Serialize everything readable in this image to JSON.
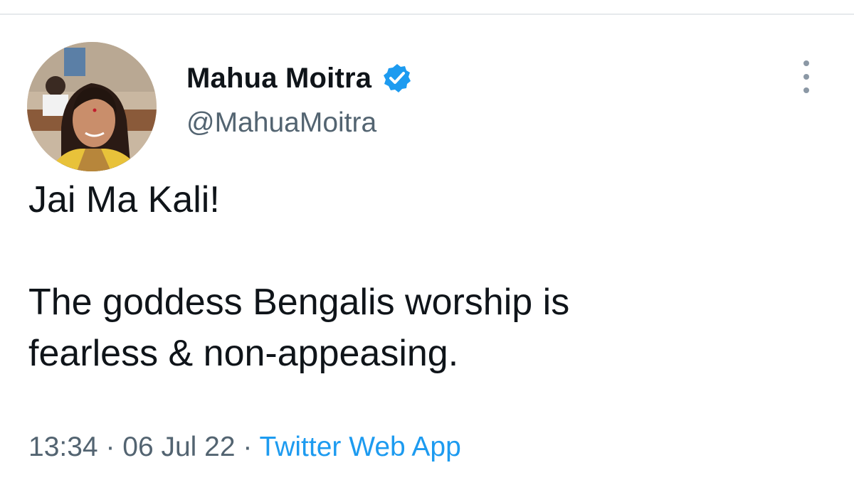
{
  "tweet": {
    "author": {
      "display_name": "Mahua Moitra",
      "handle": "@MahuaMoitra",
      "verified": true,
      "verified_color": "#1d9bf0"
    },
    "text_lines": [
      "Jai Ma Kali!",
      "",
      "The goddess Bengalis worship is",
      "fearless & non-appeasing."
    ],
    "time": "13:34",
    "date": "06 Jul 22",
    "separator": "·",
    "source": "Twitter Web App"
  },
  "icons": {
    "verified": "verified-badge-icon",
    "more": "more-options-icon"
  },
  "colors": {
    "text_primary": "#0f1419",
    "text_secondary": "#536471",
    "link": "#1d9bf0",
    "border": "#e6e9ec"
  }
}
